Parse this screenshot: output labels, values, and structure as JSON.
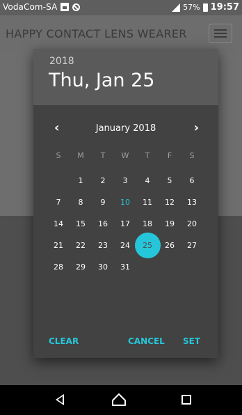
{
  "statusbar": {
    "carrier": "VodaCom-SA",
    "battery": "57%",
    "time": "19:57"
  },
  "app": {
    "title": "HAPPY CONTACT LENS WEARER"
  },
  "dialog": {
    "year": "2018",
    "date": "Thu, Jan 25",
    "month_label": "January 2018",
    "prev_glyph": "‹",
    "next_glyph": "›",
    "weekdays": [
      "S",
      "M",
      "T",
      "W",
      "T",
      "F",
      "S"
    ],
    "weeks": [
      [
        "",
        "1",
        "2",
        "3",
        "4",
        "5",
        "6"
      ],
      [
        "7",
        "8",
        "9",
        "10",
        "11",
        "12",
        "13"
      ],
      [
        "14",
        "15",
        "16",
        "17",
        "18",
        "19",
        "20"
      ],
      [
        "21",
        "22",
        "23",
        "24",
        "25",
        "26",
        "27"
      ],
      [
        "28",
        "29",
        "30",
        "31",
        "",
        "",
        ""
      ]
    ],
    "today": "10",
    "selected": "25",
    "actions": {
      "clear": "CLEAR",
      "cancel": "CANCEL",
      "set": "SET"
    }
  },
  "colors": {
    "accent": "#26c6da",
    "dialog_bg": "#424242",
    "header_bg": "#5a5a5a"
  }
}
